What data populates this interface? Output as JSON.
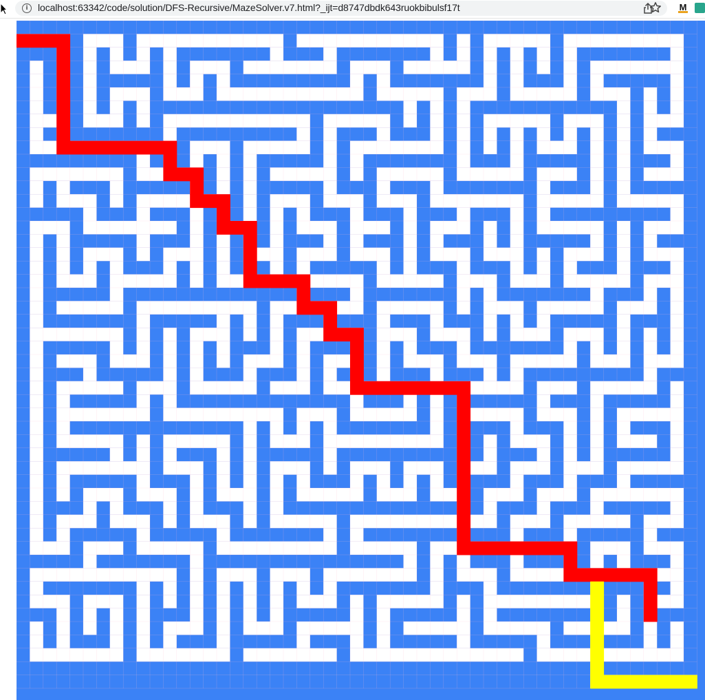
{
  "browser": {
    "url": "localhost:63342/code/solution/DFS-Recursive/MazeSolver.v7.html?_ijt=d8747dbdk643ruokbibulsf17t",
    "info_icon": "info-circle-icon",
    "share_icon": "share-icon",
    "bookmark_icon": "star-icon",
    "extension_label": "M"
  },
  "maze": {
    "grid": {
      "cols": 51,
      "rows": 50
    },
    "colors": {
      "wall": "#3b82f6",
      "passage": "#ffffff",
      "solution_path": "#ff0000",
      "current_path": "#ffff00"
    },
    "solution_path": [
      [
        0,
        1
      ],
      [
        1,
        1
      ],
      [
        2,
        1
      ],
      [
        3,
        1
      ],
      [
        3,
        2
      ],
      [
        3,
        3
      ],
      [
        3,
        4
      ],
      [
        3,
        5
      ],
      [
        3,
        6
      ],
      [
        3,
        7
      ],
      [
        3,
        8
      ],
      [
        3,
        9
      ],
      [
        4,
        9
      ],
      [
        5,
        9
      ],
      [
        6,
        9
      ],
      [
        7,
        9
      ],
      [
        8,
        9
      ],
      [
        9,
        9
      ],
      [
        10,
        9
      ],
      [
        11,
        9
      ],
      [
        11,
        10
      ],
      [
        11,
        11
      ],
      [
        12,
        11
      ],
      [
        13,
        11
      ],
      [
        13,
        12
      ],
      [
        13,
        13
      ],
      [
        14,
        13
      ],
      [
        15,
        13
      ],
      [
        15,
        14
      ],
      [
        15,
        15
      ],
      [
        16,
        15
      ],
      [
        17,
        15
      ],
      [
        17,
        16
      ],
      [
        17,
        17
      ],
      [
        17,
        18
      ],
      [
        17,
        19
      ],
      [
        18,
        19
      ],
      [
        19,
        19
      ],
      [
        20,
        19
      ],
      [
        21,
        19
      ],
      [
        21,
        20
      ],
      [
        21,
        21
      ],
      [
        22,
        21
      ],
      [
        23,
        21
      ],
      [
        23,
        22
      ],
      [
        23,
        23
      ],
      [
        24,
        23
      ],
      [
        25,
        23
      ],
      [
        25,
        24
      ],
      [
        25,
        25
      ],
      [
        25,
        26
      ],
      [
        25,
        27
      ],
      [
        26,
        27
      ],
      [
        27,
        27
      ],
      [
        28,
        27
      ],
      [
        29,
        27
      ],
      [
        30,
        27
      ],
      [
        31,
        27
      ],
      [
        32,
        27
      ],
      [
        33,
        27
      ],
      [
        33,
        28
      ],
      [
        33,
        29
      ],
      [
        33,
        30
      ],
      [
        33,
        31
      ],
      [
        33,
        32
      ],
      [
        33,
        33
      ],
      [
        33,
        34
      ],
      [
        33,
        35
      ],
      [
        33,
        36
      ],
      [
        33,
        37
      ],
      [
        33,
        38
      ],
      [
        33,
        39
      ],
      [
        34,
        39
      ],
      [
        35,
        39
      ],
      [
        36,
        39
      ],
      [
        37,
        39
      ],
      [
        38,
        39
      ],
      [
        39,
        39
      ],
      [
        40,
        39
      ],
      [
        41,
        39
      ],
      [
        41,
        40
      ],
      [
        41,
        41
      ],
      [
        42,
        41
      ],
      [
        43,
        41
      ],
      [
        44,
        41
      ],
      [
        45,
        41
      ],
      [
        46,
        41
      ],
      [
        47,
        41
      ],
      [
        47,
        42
      ],
      [
        47,
        43
      ],
      [
        47,
        44
      ]
    ],
    "current_path": [
      [
        43,
        42
      ],
      [
        43,
        43
      ],
      [
        43,
        44
      ],
      [
        43,
        45
      ],
      [
        43,
        46
      ],
      [
        43,
        47
      ],
      [
        43,
        48
      ],
      [
        43,
        49
      ],
      [
        44,
        49
      ],
      [
        45,
        49
      ],
      [
        46,
        49
      ],
      [
        47,
        49
      ],
      [
        48,
        49
      ],
      [
        49,
        49
      ],
      [
        50,
        49
      ]
    ]
  }
}
